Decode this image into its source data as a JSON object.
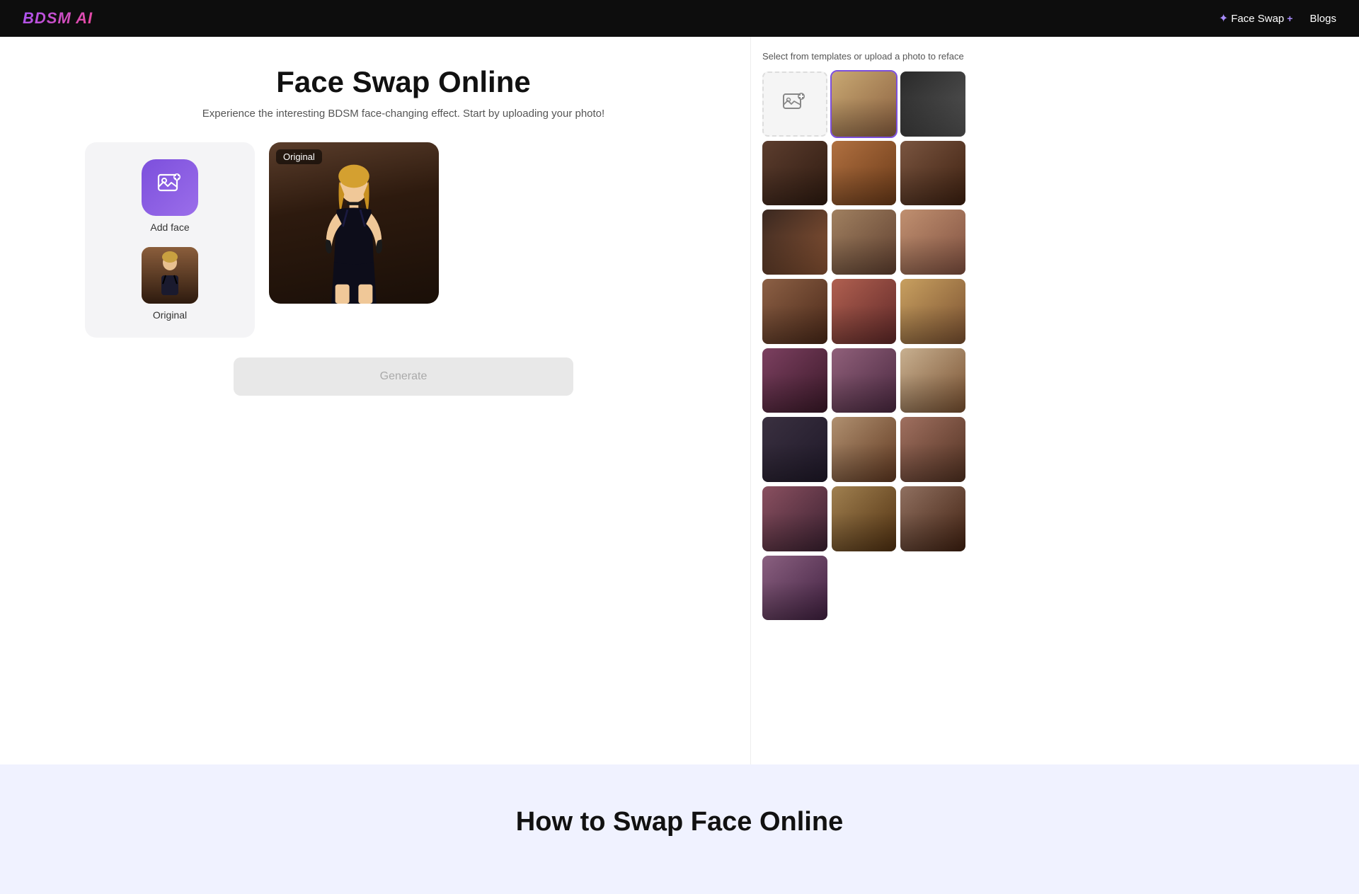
{
  "navbar": {
    "logo": "BDSM AI",
    "face_swap_label": "Face Swap",
    "blogs_label": "Blogs"
  },
  "main": {
    "title": "Face Swap Online",
    "subtitle": "Experience the interesting BDSM face-changing effect. Start by uploading your photo!",
    "original_badge": "Original",
    "add_face_label": "Add face",
    "original_label": "Original",
    "generate_label": "Generate"
  },
  "sidebar": {
    "instruction": "Select from templates or upload a photo to reface",
    "upload_icon": "⊕",
    "templates": [
      {
        "id": 1,
        "cls": "t1",
        "selected": true
      },
      {
        "id": 2,
        "cls": "t2",
        "selected": false
      },
      {
        "id": 3,
        "cls": "t3",
        "selected": false
      },
      {
        "id": 4,
        "cls": "t4",
        "selected": false
      },
      {
        "id": 5,
        "cls": "t5",
        "selected": false
      },
      {
        "id": 6,
        "cls": "t6",
        "selected": false
      },
      {
        "id": 7,
        "cls": "t7",
        "selected": false
      },
      {
        "id": 8,
        "cls": "t8",
        "selected": false
      },
      {
        "id": 9,
        "cls": "t9",
        "selected": false
      },
      {
        "id": 10,
        "cls": "t10",
        "selected": false
      },
      {
        "id": 11,
        "cls": "t11",
        "selected": false
      },
      {
        "id": 12,
        "cls": "t12",
        "selected": false
      },
      {
        "id": 13,
        "cls": "t13",
        "selected": false
      },
      {
        "id": 14,
        "cls": "t14",
        "selected": false
      },
      {
        "id": 15,
        "cls": "t15",
        "selected": false
      },
      {
        "id": 16,
        "cls": "t16",
        "selected": false
      },
      {
        "id": 17,
        "cls": "t17",
        "selected": false
      },
      {
        "id": 18,
        "cls": "t18",
        "selected": false
      },
      {
        "id": 19,
        "cls": "t19",
        "selected": false
      },
      {
        "id": 20,
        "cls": "t20",
        "selected": false
      },
      {
        "id": 21,
        "cls": "t21",
        "selected": false
      }
    ]
  },
  "bottom": {
    "title": "How to Swap Face Online"
  }
}
